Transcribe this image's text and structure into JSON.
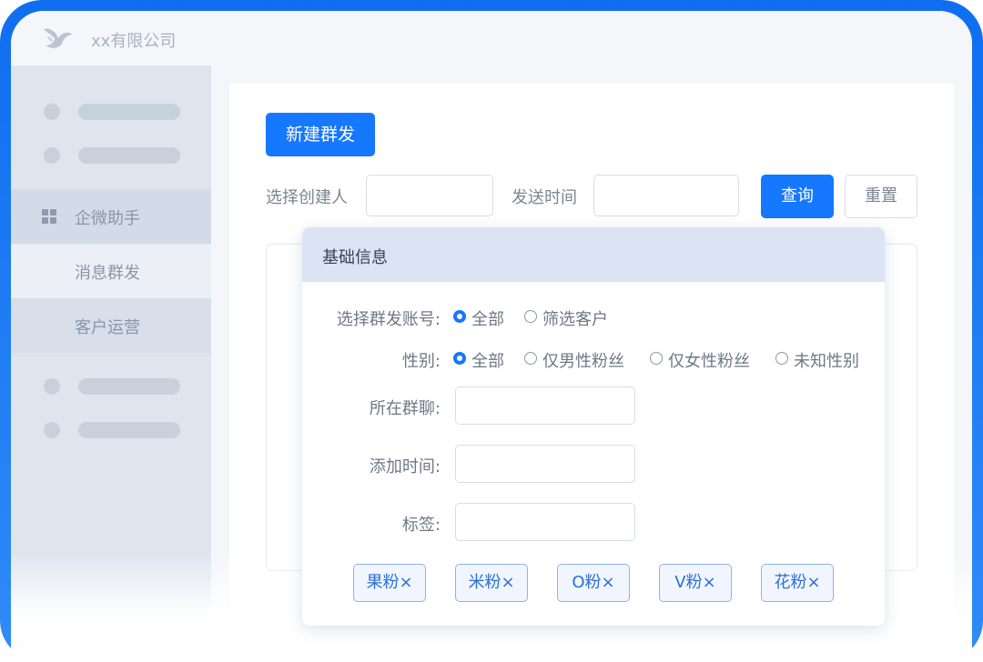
{
  "app": {
    "company_name": "xx有限公司"
  },
  "sidebar": {
    "group_label": "企微助手",
    "items": [
      {
        "label": "消息群发"
      },
      {
        "label": "客户运营"
      }
    ]
  },
  "toolbar": {
    "new_button": "新建群发",
    "creator_label": "选择创建人",
    "creator_value": "",
    "send_time_label": "发送时间",
    "send_time_value": "",
    "query_button": "查询",
    "reset_button": "重置"
  },
  "modal": {
    "title": "基础信息",
    "account_label": "选择群发账号:",
    "account_options": [
      "全部",
      "筛选客户"
    ],
    "account_selected": "全部",
    "gender_label": "性别:",
    "gender_options": [
      "全部",
      "仅男性粉丝",
      "仅女性粉丝",
      "未知性别"
    ],
    "gender_selected": "全部",
    "group_chat_label": "所在群聊:",
    "group_chat_value": "",
    "add_time_label": "添加时间:",
    "add_time_value": "",
    "tags_label": "标签:",
    "tags_value": "",
    "tags": [
      "果粉×",
      "米粉×",
      "O粉×",
      "V粉×",
      "花粉×"
    ]
  },
  "colors": {
    "primary": "#1677ff",
    "frame": "#0f6ef0",
    "sidebar_bg": "#dfe5ef",
    "modal_header": "#dbe4f4"
  },
  "icons": [
    "logo-bird-icon",
    "grid-icon",
    "radio-icon"
  ]
}
